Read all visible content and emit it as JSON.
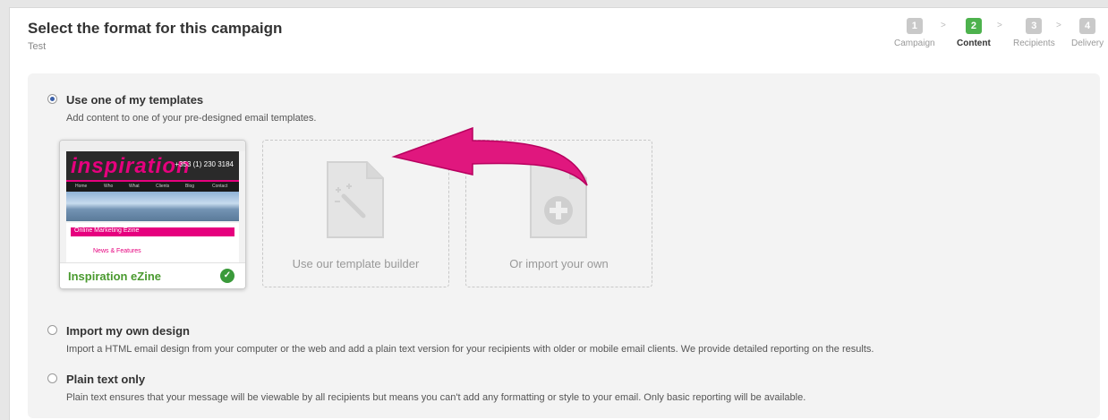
{
  "header": {
    "title": "Select the format for this campaign",
    "subtitle": "Test"
  },
  "steps": [
    {
      "num": "1",
      "label": "Campaign",
      "active": false
    },
    {
      "num": "2",
      "label": "Content",
      "active": true
    },
    {
      "num": "3",
      "label": "Recipients",
      "active": false
    },
    {
      "num": "4",
      "label": "Delivery",
      "active": false
    }
  ],
  "step_separator": ">",
  "options": {
    "templates": {
      "title": "Use one of my templates",
      "desc": "Add content to one of your pre-designed email templates.",
      "selected": true
    },
    "import": {
      "title": "Import my own design",
      "desc": "Import a HTML email design from your computer or the web and add a plain text version for your recipients with older or mobile email clients. We provide detailed reporting on the results.",
      "selected": false
    },
    "plain": {
      "title": "Plain text only",
      "desc": "Plain text ensures that your message will be viewable by all recipients but means you can't add any formatting or style to your email. Only basic reporting will be available.",
      "selected": false
    }
  },
  "cards": {
    "template": {
      "name": "Inspiration eZine",
      "thumb_logo": "inspiration",
      "thumb_phone": "+353 (1) 230 3184",
      "thumb_nav": [
        "Home",
        "Who",
        "What",
        "Clients",
        "Blog",
        "Contact"
      ],
      "thumb_banner": "Online Marketing Ezine",
      "thumb_news": "News & Features"
    },
    "builder": {
      "label": "Use our template builder",
      "icon": "magic-wand-document-icon"
    },
    "import": {
      "label": "Or import your own",
      "icon": "add-document-icon"
    }
  },
  "colors": {
    "accent_green": "#4db24d",
    "brand_pink": "#e6007e",
    "arrow": "#e0177e"
  }
}
